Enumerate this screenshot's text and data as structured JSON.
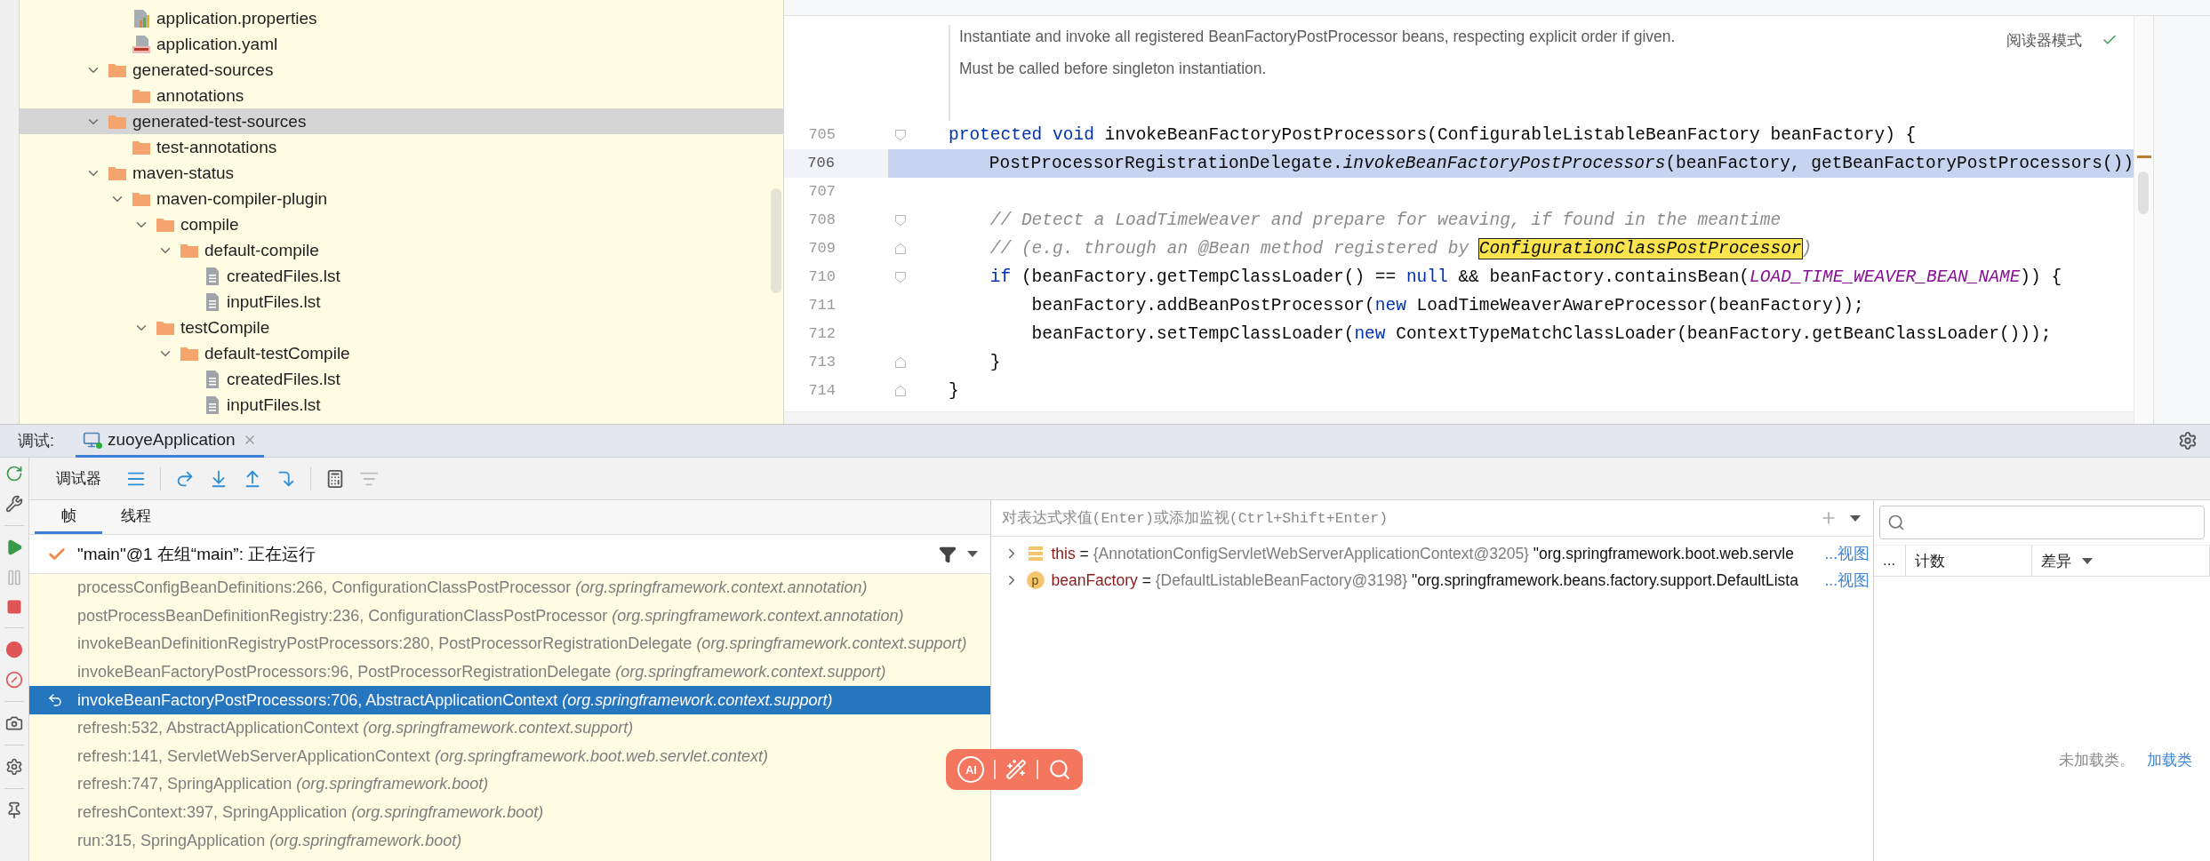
{
  "tree": {
    "continued_items": [
      {
        "kind": "properties",
        "label": "application.properties",
        "selected": false
      },
      {
        "kind": "yaml",
        "label": "application.yaml",
        "selected": false
      }
    ],
    "items": [
      {
        "kind": "folder",
        "label": "generated-sources",
        "expanded": true,
        "selected": false,
        "children": [
          {
            "kind": "folder",
            "label": "annotations",
            "selected": false
          }
        ]
      },
      {
        "kind": "folder",
        "label": "generated-test-sources",
        "expanded": true,
        "selected": true,
        "children": [
          {
            "kind": "folder",
            "label": "test-annotations",
            "selected": false
          }
        ]
      },
      {
        "kind": "folder",
        "label": "maven-status",
        "expanded": true,
        "selected": false,
        "children": [
          {
            "kind": "folder",
            "label": "maven-compiler-plugin",
            "expanded": true,
            "selected": false,
            "children": [
              {
                "kind": "folder",
                "label": "compile",
                "expanded": true,
                "selected": false,
                "children": [
                  {
                    "kind": "folder",
                    "label": "default-compile",
                    "expanded": true,
                    "selected": false,
                    "children": [
                      {
                        "kind": "text",
                        "label": "createdFiles.lst",
                        "selected": false
                      },
                      {
                        "kind": "text",
                        "label": "inputFiles.lst",
                        "selected": false
                      }
                    ]
                  }
                ]
              },
              {
                "kind": "folder",
                "label": "testCompile",
                "expanded": true,
                "selected": false,
                "children": [
                  {
                    "kind": "folder",
                    "label": "default-testCompile",
                    "expanded": true,
                    "selected": false,
                    "children": [
                      {
                        "kind": "text",
                        "label": "createdFiles.lst",
                        "selected": false
                      },
                      {
                        "kind": "text",
                        "label": "inputFiles.lst",
                        "selected": false
                      }
                    ]
                  }
                ]
              }
            ]
          }
        ]
      }
    ]
  },
  "editor": {
    "doc": [
      "Instantiate and invoke all registered BeanFactoryPostProcessor beans, respecting explicit order if given.",
      "Must be called before singleton instantiation."
    ],
    "reader_mode": "阅读器模式",
    "lines": [
      {
        "number": "705",
        "current": false,
        "fold_open": true,
        "tokens": [
          {
            "kind": "kw",
            "text": "protected"
          },
          {
            "kind": "kw",
            "text": " void"
          },
          {
            "kind": "plain",
            "text": " invokeBeanFactoryPostProcessors(ConfigurableListableBeanFactory beanFactory) {"
          }
        ]
      },
      {
        "number": "706",
        "current": true,
        "tokens": [
          {
            "kind": "plain",
            "text": "    PostProcessorRegistrationDelegate."
          },
          {
            "kind": "italic",
            "text": "invokeBeanFactoryPostProcessors"
          },
          {
            "kind": "plain",
            "text": "(beanFactory, getBeanFactoryPostProcessors())"
          }
        ]
      },
      {
        "number": "707",
        "current": false
      },
      {
        "number": "708",
        "current": false,
        "fold_open": true,
        "tokens": [
          {
            "kind": "comment",
            "text": "    // Detect a LoadTimeWeaver and prepare for weaving, if found in the meantime"
          }
        ]
      },
      {
        "number": "709",
        "current": false,
        "fold_close": true,
        "tokens": [
          {
            "kind": "comment",
            "text": "    // (e.g. through an @Bean method registered by "
          },
          {
            "kind": "hit",
            "text": "ConfigurationClassPostProcessor"
          },
          {
            "kind": "comment",
            "text": ")"
          }
        ]
      },
      {
        "number": "710",
        "current": false,
        "fold_open": true,
        "tokens": [
          {
            "kind": "kw",
            "text": "    if"
          },
          {
            "kind": "plain",
            "text": " (beanFactory.getTempClassLoader() == "
          },
          {
            "kind": "kw",
            "text": "null"
          },
          {
            "kind": "plain",
            "text": " && beanFactory.containsBean("
          },
          {
            "kind": "const",
            "text": "LOAD_TIME_WEAVER_BEAN_NAME"
          },
          {
            "kind": "plain",
            "text": ")) {"
          }
        ]
      },
      {
        "number": "711",
        "current": false,
        "tokens": [
          {
            "kind": "plain",
            "text": "        beanFactory.addBeanPostProcessor("
          },
          {
            "kind": "kw",
            "text": "new"
          },
          {
            "kind": "plain",
            "text": " LoadTimeWeaverAwareProcessor(beanFactory));"
          }
        ]
      },
      {
        "number": "712",
        "current": false,
        "tokens": [
          {
            "kind": "plain",
            "text": "        beanFactory.setTempClassLoader("
          },
          {
            "kind": "kw",
            "text": "new"
          },
          {
            "kind": "plain",
            "text": " ContextTypeMatchClassLoader(beanFactory.getBeanClassLoader()));"
          }
        ]
      },
      {
        "number": "713",
        "current": false,
        "fold_close": true,
        "tokens": [
          {
            "kind": "plain",
            "text": "    }"
          }
        ]
      },
      {
        "number": "714",
        "current": false,
        "fold_close": true,
        "tokens": [
          {
            "kind": "plain",
            "text": "}"
          }
        ]
      }
    ]
  },
  "debug": {
    "label": "调试:",
    "session_tab": {
      "title": "zuoyeApplication",
      "selected": true
    },
    "toolbar_label": "调试器",
    "tabs": [
      {
        "label": "帧",
        "selected": true
      },
      {
        "label": "线程",
        "selected": false
      }
    ],
    "thread": "\"main\"@1 在组“main”: 正在运行",
    "frames": [
      {
        "text": "processConfigBeanDefinitions:266, ConfigurationClassPostProcessor",
        "package": "(org.springframework.context.annotation)",
        "selected": false
      },
      {
        "text": "postProcessBeanDefinitionRegistry:236, ConfigurationClassPostProcessor",
        "package": "(org.springframework.context.annotation)",
        "selected": false
      },
      {
        "text": "invokeBeanDefinitionRegistryPostProcessors:280, PostProcessorRegistrationDelegate",
        "package": "(org.springframework.context.support)",
        "selected": false
      },
      {
        "text": "invokeBeanFactoryPostProcessors:96, PostProcessorRegistrationDelegate",
        "package": "(org.springframework.context.support)",
        "selected": false
      },
      {
        "text": "invokeBeanFactoryPostProcessors:706, AbstractApplicationContext",
        "package": "(org.springframework.context.support)",
        "selected": true
      },
      {
        "text": "refresh:532, AbstractApplicationContext",
        "package": "(org.springframework.context.support)",
        "selected": false
      },
      {
        "text": "refresh:141, ServletWebServerApplicationContext",
        "package": "(org.springframework.boot.web.servlet.context)",
        "selected": false
      },
      {
        "text": "refresh:747, SpringApplication",
        "package": "(org.springframework.boot)",
        "selected": false
      },
      {
        "text": "refreshContext:397, SpringApplication",
        "package": "(org.springframework.boot)",
        "selected": false
      },
      {
        "text": "run:315, SpringApplication",
        "package": "(org.springframework.boot)",
        "selected": false
      }
    ],
    "eval_placeholder": "对表达式求值(Enter)或添加监视(Ctrl+Shift+Enter)",
    "variables": [
      {
        "kind": "field",
        "name": "this",
        "operator": "=",
        "type": "{AnnotationConfigServletWebServerApplicationContext@3205}",
        "value": "\"org.springframework.boot.web.servle",
        "link": "...视图"
      },
      {
        "kind": "param",
        "badge": "p",
        "name": "beanFactory",
        "operator": "=",
        "type": "{DefaultListableBeanFactory@3198}",
        "value": "\"org.springframework.beans.factory.support.DefaultLista",
        "link": "...视图"
      }
    ],
    "memory": {
      "columns": [
        "...",
        "计数",
        "差异"
      ],
      "empty_text": "未加载类。",
      "load_link": "加载类"
    },
    "assistant_bar": {
      "label": "AI"
    }
  }
}
